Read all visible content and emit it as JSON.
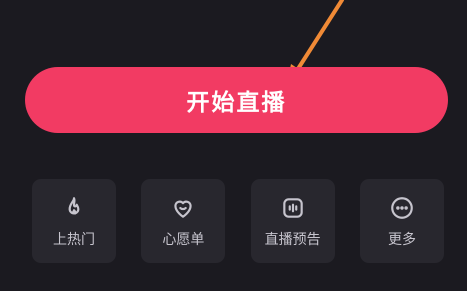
{
  "primary_action": {
    "label": "开始直播"
  },
  "tiles": [
    {
      "label": "上热门",
      "icon": "flame-icon"
    },
    {
      "label": "心愿单",
      "icon": "heart-smile-icon"
    },
    {
      "label": "直播预告",
      "icon": "live-preview-icon"
    },
    {
      "label": "更多",
      "icon": "more-dots-icon"
    }
  ],
  "colors": {
    "background": "#1b1a20",
    "button": "#f23b63",
    "tile": "#28272e",
    "text": "#c6c4cd",
    "annotation_arrow": "#f08a36"
  }
}
